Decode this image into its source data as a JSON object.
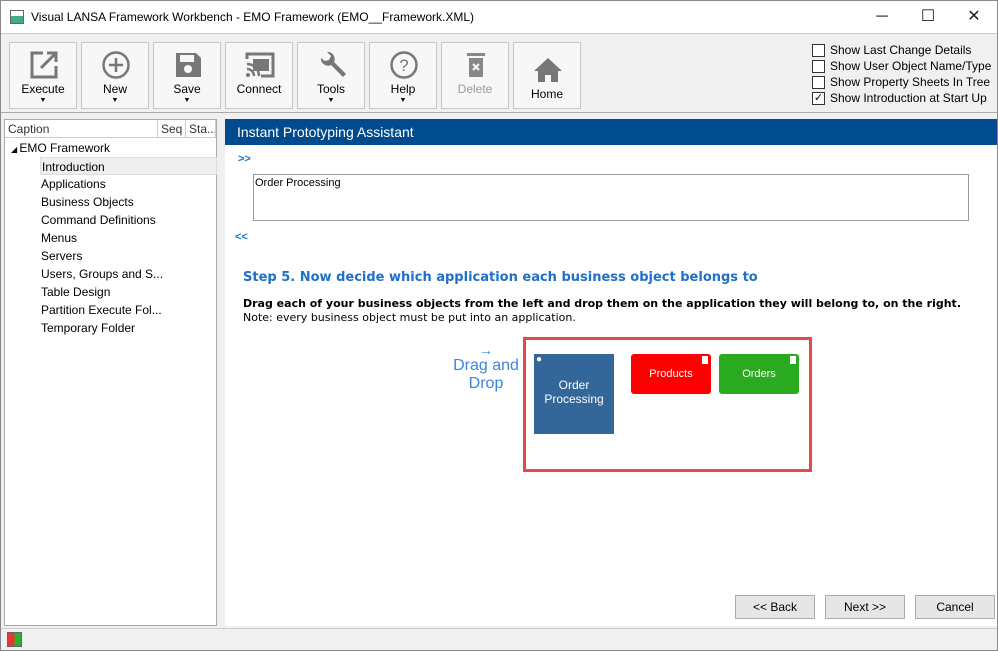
{
  "window": {
    "title": "Visual LANSA Framework Workbench - EMO Framework (EMO__Framework.XML)",
    "minimize": "─",
    "maximize": "☐",
    "close": "✕"
  },
  "toolbar": {
    "buttons": [
      {
        "label": "Execute",
        "icon": "external-link-icon",
        "dropdown": true
      },
      {
        "label": "New",
        "icon": "plus-circle-icon",
        "dropdown": true
      },
      {
        "label": "Save",
        "icon": "save-icon",
        "dropdown": true
      },
      {
        "label": "Connect",
        "icon": "cast-icon",
        "dropdown": false
      },
      {
        "label": "Tools",
        "icon": "wrench-icon",
        "dropdown": true
      },
      {
        "label": "Help",
        "icon": "help-icon",
        "dropdown": true
      },
      {
        "label": "Delete",
        "icon": "trash-icon",
        "dropdown": false,
        "disabled": true
      },
      {
        "label": "Home",
        "icon": "home-icon",
        "dropdown": false
      }
    ],
    "arrow": "▼",
    "options": [
      {
        "label": "Show Last Change Details",
        "checked": false
      },
      {
        "label": "Show User Object Name/Type",
        "checked": false
      },
      {
        "label": "Show Property Sheets In Tree",
        "checked": false
      },
      {
        "label": "Show Introduction at Start Up",
        "checked": true
      }
    ]
  },
  "tree": {
    "columns": [
      "Caption",
      "Seq",
      "Sta..."
    ],
    "root": "EMO Framework",
    "items": [
      "Introduction",
      "Applications",
      "Business Objects",
      "Command Definitions",
      "Menus",
      "Servers",
      "Users, Groups and S...",
      "Table Design",
      "Partition Execute Fol...",
      "Temporary Folder"
    ],
    "selected": "Introduction"
  },
  "main": {
    "header": "Instant Prototyping Assistant",
    "expand": ">>",
    "collapse": "<<",
    "input_value": "Order Processing",
    "step_title": "Step 5. Now decide which application each business object belongs to",
    "instruction": "Drag each of your business objects from the left and drop them on the application they will belong to, on the right.",
    "note": "Note: every business object must be put into an application.",
    "drag_arrow": "→",
    "drag_label": "Drag and Drop",
    "application": {
      "label": "Order Processing",
      "color": "#336699"
    },
    "objects": [
      {
        "label": "Products",
        "color": "#ff0000"
      },
      {
        "label": "Orders",
        "color": "#2aaa1e"
      }
    ],
    "back": "<< Back",
    "next": "Next >>",
    "cancel": "Cancel"
  }
}
